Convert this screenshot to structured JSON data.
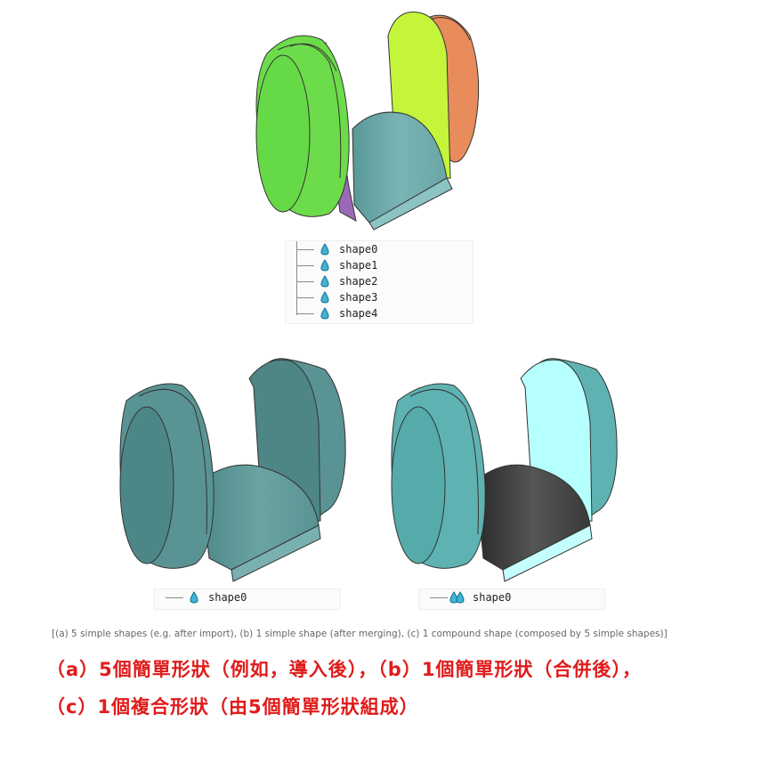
{
  "figure_a": {
    "tree_items": [
      "shape0",
      "shape1",
      "shape2",
      "shape3",
      "shape4"
    ],
    "colors": {
      "green": "#6ddc4a",
      "yellow": "#c4f53a",
      "orange": "#e88c5c",
      "purple": "#9a6ab8",
      "teal": "#6aa3a3"
    }
  },
  "figure_b": {
    "tree_items": [
      "shape0"
    ],
    "colors": {
      "teal": "#5a9393"
    }
  },
  "figure_c": {
    "tree_items": [
      "shape0"
    ],
    "colors": {
      "teal": "#5fb2b2",
      "cyan": "#b6ffff",
      "grey": "#3a3a3a"
    }
  },
  "captions": {
    "english": "[(a) 5 simple shapes (e.g. after import), (b) 1 simple shape (after merging), (c) 1 compound shape (composed by 5 simple shapes)]",
    "chinese_line1": "（a）5個簡單形狀（例如，導入後），（b）1個簡單形狀（合併後），",
    "chinese_line2": "（c）1個複合形狀（由5個簡單形狀組成）",
    "color": "#e01b1b"
  }
}
